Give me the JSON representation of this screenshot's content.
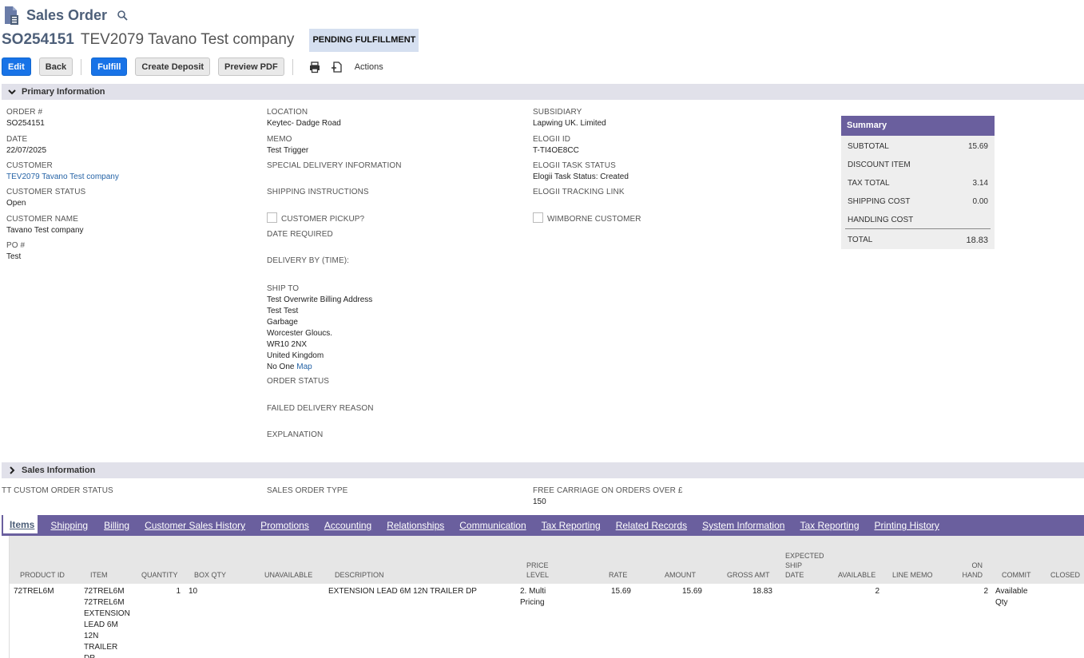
{
  "header": {
    "title": "Sales Order",
    "record_number": "SO254151",
    "record_name": "TEV2079 Tavano Test company",
    "status": "PENDING FULFILLMENT"
  },
  "toolbar": {
    "edit": "Edit",
    "back": "Back",
    "fulfill": "Fulfill",
    "create_deposit": "Create Deposit",
    "preview_pdf": "Preview PDF",
    "actions": "Actions"
  },
  "primary": {
    "section_title": "Primary Information",
    "order_label": "ORDER #",
    "order_value": "SO254151",
    "date_label": "DATE",
    "date_value": "22/07/2025",
    "customer_label": "CUSTOMER",
    "customer_value": "TEV2079 Tavano Test company",
    "customer_status_label": "CUSTOMER STATUS",
    "customer_status_value": "Open",
    "customer_name_label": "CUSTOMER NAME",
    "customer_name_value": "Tavano Test company",
    "po_label": "PO #",
    "po_value": "Test",
    "location_label": "LOCATION",
    "location_value": "Keytec- Dadge Road",
    "memo_label": "MEMO",
    "memo_value": "Test Trigger",
    "special_delivery_label": "SPECIAL DELIVERY INFORMATION",
    "shipping_instructions_label": "SHIPPING INSTRUCTIONS",
    "customer_pickup_label": "CUSTOMER PICKUP?",
    "date_required_label": "DATE REQUIRED",
    "delivery_by_label": "DELIVERY BY (TIME):",
    "ship_to_label": "SHIP TO",
    "ship_to_lines": [
      "Test Overwrite Billing Address",
      "Test Test",
      "Garbage",
      "Worcester Gloucs.",
      "WR10 2NX",
      "United Kingdom"
    ],
    "ship_to_last": "No One",
    "map_link": "Map",
    "order_status_label": "ORDER STATUS",
    "failed_delivery_label": "FAILED DELIVERY REASON",
    "explanation_label": "EXPLANATION",
    "subsidiary_label": "SUBSIDIARY",
    "subsidiary_value": "Lapwing UK. Limited",
    "elogii_id_label": "ELOGII ID",
    "elogii_id_value": "T-TI4OE8CC",
    "elogii_task_status_label": "ELOGII TASK STATUS",
    "elogii_task_status_value": "Elogii Task Status: Created",
    "elogii_tracking_label": "ELOGII TRACKING LINK",
    "wimborne_label": "WIMBORNE CUSTOMER"
  },
  "summary": {
    "title": "Summary",
    "subtotal_label": "SUBTOTAL",
    "subtotal_value": "15.69",
    "discount_label": "DISCOUNT ITEM",
    "tax_label": "TAX TOTAL",
    "tax_value": "3.14",
    "shipping_label": "SHIPPING COST",
    "shipping_value": "0.00",
    "handling_label": "HANDLING COST",
    "total_label": "TOTAL",
    "total_value": "18.83"
  },
  "sales": {
    "section_title": "Sales Information",
    "tt_status_label": "TT CUSTOM ORDER STATUS",
    "sales_order_type_label": "SALES ORDER TYPE",
    "free_carriage_label": "FREE CARRIAGE ON ORDERS OVER £",
    "free_carriage_value": "150"
  },
  "tabs": [
    "Items",
    "Shipping",
    "Billing",
    "Customer Sales History",
    "Promotions",
    "Accounting",
    "Relationships",
    "Communication",
    "Tax Reporting",
    "Related Records",
    "System Information",
    "Tax Reporting",
    "Printing History"
  ],
  "items_table": {
    "headers": {
      "product_id": "PRODUCT ID",
      "item": "ITEM",
      "quantity": "QUANTITY",
      "box_qty": "BOX QTY",
      "unavailable": "UNAVAILABLE",
      "description": "DESCRIPTION",
      "price_level_1": "PRICE",
      "price_level_2": "LEVEL",
      "rate": "RATE",
      "amount": "AMOUNT",
      "gross_amt": "GROSS AMT",
      "expected_1": "EXPECTED",
      "expected_2": "SHIP",
      "expected_3": "DATE",
      "available": "AVAILABLE",
      "line_memo": "LINE MEMO",
      "on_hand_1": "ON",
      "on_hand_2": "HAND",
      "commit": "COMMIT",
      "closed": "CLOSED"
    },
    "row": {
      "product_id": "72TREL6M",
      "item_lines": [
        "72TREL6M",
        "72TREL6M",
        "EXTENSION",
        "LEAD 6M",
        "12N",
        "TRAILER",
        "DP"
      ],
      "quantity": "1",
      "box_qty": "10",
      "description": "EXTENSION LEAD 6M 12N TRAILER DP",
      "price_level_1": "2. Multi",
      "price_level_2": "Pricing",
      "rate": "15.69",
      "amount": "15.69",
      "gross_amt": "18.83",
      "available": "2",
      "on_hand": "2",
      "commit_1": "Available",
      "commit_2": "Qty"
    }
  }
}
